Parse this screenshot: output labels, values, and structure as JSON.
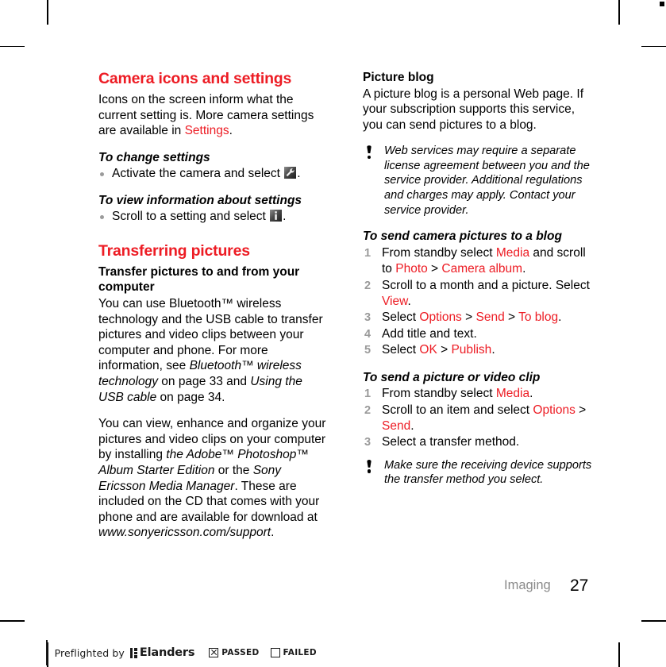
{
  "document": {
    "footer_chapter": "Imaging",
    "page_number": "27",
    "accent_color": "#ED1C24",
    "step_number_color": "#9A9A9A",
    "bullet_color": "#9B9B9B"
  },
  "left_column": {
    "section_title": "Camera icons and settings",
    "intro_paragraph": {
      "part1": "Icons on the screen inform what the current setting is. More camera settings are available in ",
      "link": "Settings",
      "part2": "."
    },
    "procedure_change_settings": {
      "title": "To change settings",
      "bullet": {
        "text_before": "Activate the camera and select ",
        "icon": "wrench-settings-icon",
        "text_after": "."
      }
    },
    "procedure_view_info": {
      "title": "To view information about settings",
      "bullet": {
        "text_before": "Scroll to a setting and select ",
        "icon": "info-icon",
        "text_after": "."
      }
    },
    "section_title_2": "Transferring pictures",
    "transfer_subtitle": "Transfer pictures to and from your computer",
    "transfer_paragraph": {
      "part1": "You can use Bluetooth™ wireless technology and the USB cable to transfer pictures and video clips between your computer and phone. For more information, see ",
      "italic1": "Bluetooth™ wireless technology",
      "part2": " on page 33 and ",
      "italic2": "Using the USB cable",
      "part3": " on page 34."
    },
    "software_paragraph": {
      "part1": "You can view, enhance and organize your pictures and video clips on your computer by installing ",
      "italic1": "the Adobe™ Photoshop™ Album Starter Edition",
      "part2": " or the ",
      "italic2": "Sony Ericsson Media Manager",
      "part3": ". These are included on the CD that comes with your phone and are available for download at ",
      "italic3": "www.sonyericsson.com/support",
      "part4": "."
    }
  },
  "right_column": {
    "picture_blog_title": "Picture blog",
    "picture_blog_paragraph": "A picture blog is a personal Web page. If your subscription supports this service, you can send pictures to a blog.",
    "note_web_services": "Web services may require a separate license agreement between you and the service provider. Additional regulations and charges may apply. Contact your service provider.",
    "procedure_blog": {
      "title": "To send camera pictures to a blog",
      "steps": [
        {
          "segments": [
            {
              "t": "From standby select ",
              "style": "plain"
            },
            {
              "t": "Media",
              "style": "red"
            },
            {
              "t": " and scroll to ",
              "style": "plain"
            },
            {
              "t": "Photo",
              "style": "red"
            },
            {
              "t": " > ",
              "style": "plain"
            },
            {
              "t": "Camera album",
              "style": "red"
            },
            {
              "t": ".",
              "style": "plain"
            }
          ]
        },
        {
          "segments": [
            {
              "t": "Scroll to a month and a picture. Select ",
              "style": "plain"
            },
            {
              "t": "View",
              "style": "red"
            },
            {
              "t": ".",
              "style": "plain"
            }
          ]
        },
        {
          "segments": [
            {
              "t": "Select ",
              "style": "plain"
            },
            {
              "t": "Options",
              "style": "red"
            },
            {
              "t": " > ",
              "style": "plain"
            },
            {
              "t": "Send",
              "style": "red"
            },
            {
              "t": " > ",
              "style": "plain"
            },
            {
              "t": "To blog",
              "style": "red"
            },
            {
              "t": ".",
              "style": "plain"
            }
          ]
        },
        {
          "segments": [
            {
              "t": "Add title and text.",
              "style": "plain"
            }
          ]
        },
        {
          "segments": [
            {
              "t": "Select ",
              "style": "plain"
            },
            {
              "t": "OK",
              "style": "red"
            },
            {
              "t": " > ",
              "style": "plain"
            },
            {
              "t": "Publish",
              "style": "red"
            },
            {
              "t": ".",
              "style": "plain"
            }
          ]
        }
      ]
    },
    "procedure_send": {
      "title": "To send a picture or video clip",
      "steps": [
        {
          "segments": [
            {
              "t": "From standby select ",
              "style": "plain"
            },
            {
              "t": "Media",
              "style": "red"
            },
            {
              "t": ".",
              "style": "plain"
            }
          ]
        },
        {
          "segments": [
            {
              "t": "Scroll to an item and select ",
              "style": "plain"
            },
            {
              "t": "Options",
              "style": "red"
            },
            {
              "t": " > ",
              "style": "plain"
            },
            {
              "t": "Send",
              "style": "red"
            },
            {
              "t": ".",
              "style": "plain"
            }
          ]
        },
        {
          "segments": [
            {
              "t": "Select a transfer method.",
              "style": "plain"
            }
          ]
        }
      ]
    },
    "note_transfer": "Make sure the receiving device supports the transfer method you select."
  },
  "preflight_bar": {
    "prefix": "Preflighted by",
    "logo_word": "Elanders",
    "passed_label": "PASSED",
    "failed_label": "FAILED",
    "passed_checked": true,
    "failed_checked": false
  }
}
